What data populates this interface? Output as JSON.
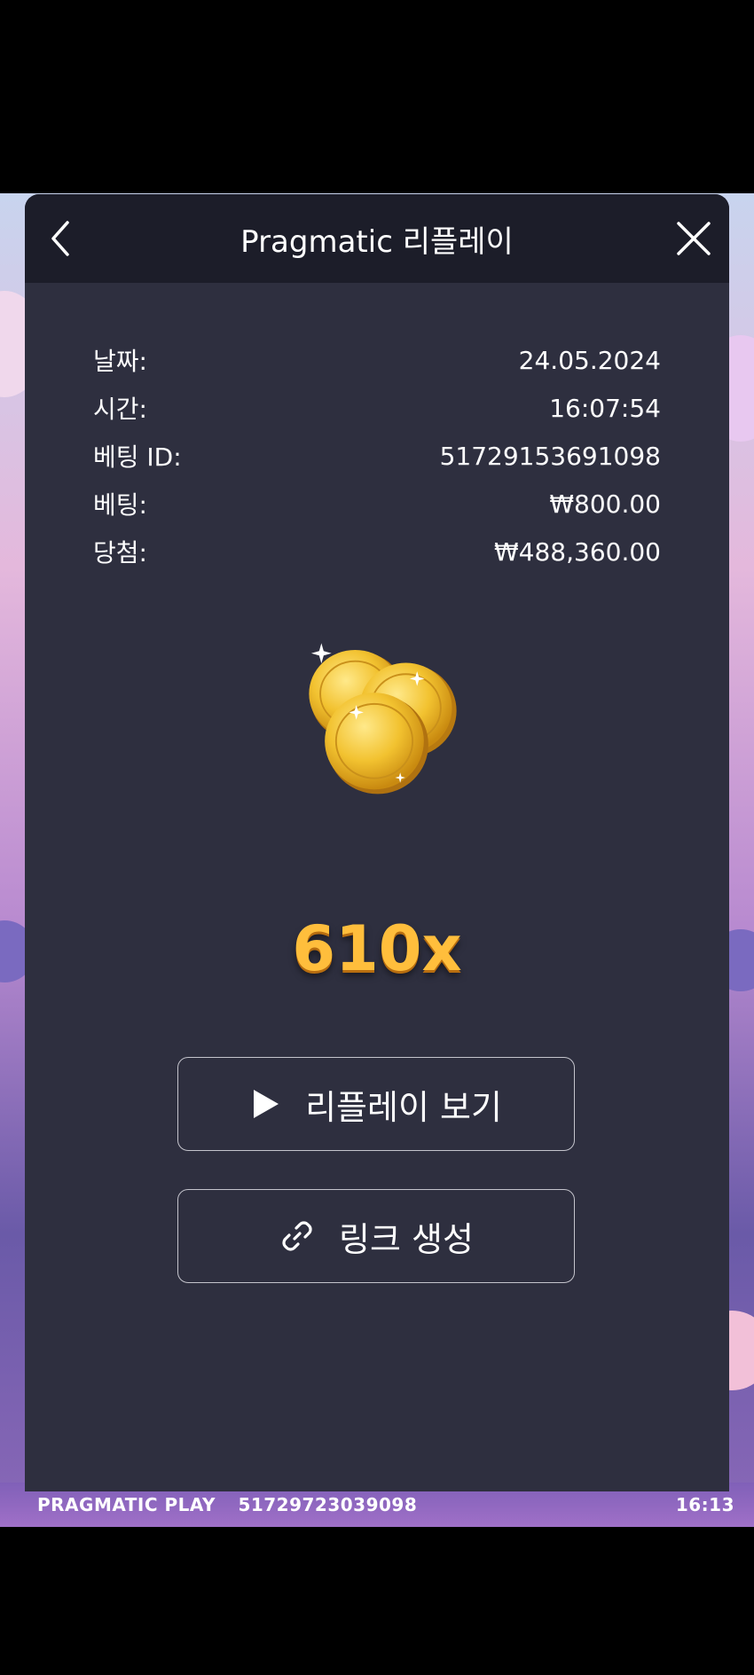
{
  "game": {
    "footer_brand": "PRAGMATIC PLAY",
    "footer_id": "51729723039098",
    "footer_time": "16:13"
  },
  "modal": {
    "title": "Pragmatic 리플레이",
    "back_icon": "chevron-left-icon",
    "close_icon": "close-icon",
    "details": [
      {
        "label": "날짜:",
        "value": "24.05.2024"
      },
      {
        "label": "시간:",
        "value": "16:07:54"
      },
      {
        "label": "베팅 ID:",
        "value": "51729153691098"
      },
      {
        "label": "베팅:",
        "value": "₩800.00"
      },
      {
        "label": "당첨:",
        "value": "₩488,360.00"
      }
    ],
    "win_icon": "gold-coins-icon",
    "multiplier": "610x",
    "buttons": {
      "replay_label": "리플레이 보기",
      "replay_icon": "play-icon",
      "link_label": "링크 생성",
      "link_icon": "link-icon"
    }
  },
  "colors": {
    "modal_bg": "#2e2f3f",
    "header_bg": "#1c1d29",
    "multiplier": "#ffbe3c",
    "coin_gold": "#f2c230"
  }
}
